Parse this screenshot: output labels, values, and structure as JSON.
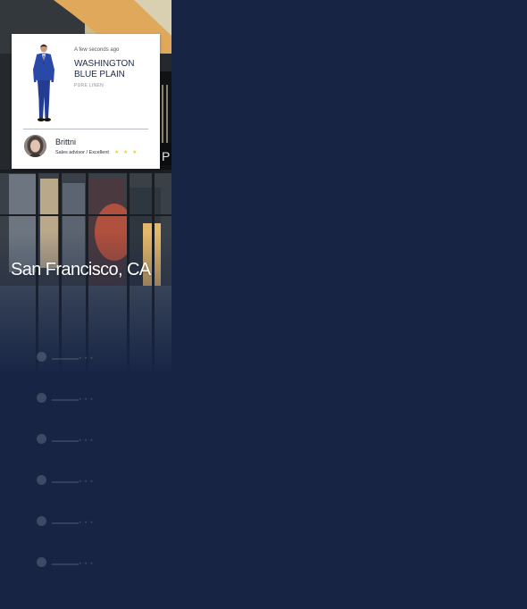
{
  "location": {
    "city": "San Francisco, CA"
  },
  "card": {
    "time": "A few seconds ago",
    "product_name": "WASHINGTON BLUE PLAIN",
    "fabric": "PURE LINEN",
    "advisor": {
      "name": "Brittni",
      "role": "Sales advisor / Excellent",
      "rating_stars": "★ ★ ★",
      "rating": 3
    }
  },
  "feed": {
    "rows": [
      {
        "name": "",
        "stars": "★ ★ ★"
      },
      {
        "name": "",
        "stars": "★ ★ ★"
      },
      {
        "name": "",
        "stars": "★ ★ ★"
      },
      {
        "name": "",
        "stars": "★ ★ ★"
      },
      {
        "name": "",
        "stars": "★ ★ ★"
      },
      {
        "name": "",
        "stars": "★ ★ ★"
      }
    ]
  },
  "colors": {
    "background": "#172444",
    "card": "#ffffff",
    "product_text": "#1d2a4a",
    "star": "#e9d23a"
  }
}
